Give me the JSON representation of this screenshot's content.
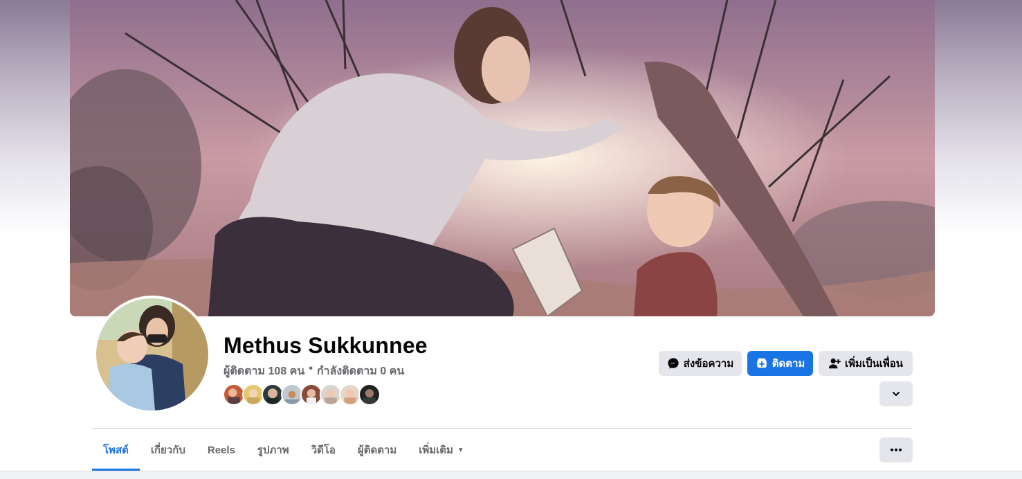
{
  "profile": {
    "name": "Methus Sukkunnee",
    "followers": "ผู้ติดตาม 108 คน",
    "separator": "•",
    "following": "กำลังติดตาม 0 คน",
    "follower_faces_count": 8
  },
  "actions": {
    "message_label": "ส่งข้อความ",
    "follow_label": "ติดตาม",
    "add_friend_label": "เพิ่มเป็นเพื่อน",
    "expand_icon": "chevron-down-icon",
    "more_icon": "ellipsis-icon"
  },
  "tabs": [
    {
      "label": "โพสต์",
      "active": true
    },
    {
      "label": "เกี่ยวกับ",
      "active": false
    },
    {
      "label": "Reels",
      "active": false
    },
    {
      "label": "รูปภาพ",
      "active": false
    },
    {
      "label": "วิดีโอ",
      "active": false
    },
    {
      "label": "ผู้ติดตาม",
      "active": false
    },
    {
      "label": "เพิ่มเติม",
      "active": false
    }
  ],
  "colors": {
    "accent": "#1b74e4",
    "button_gray": "#e4e6eb",
    "secondary_text": "#65676b"
  }
}
